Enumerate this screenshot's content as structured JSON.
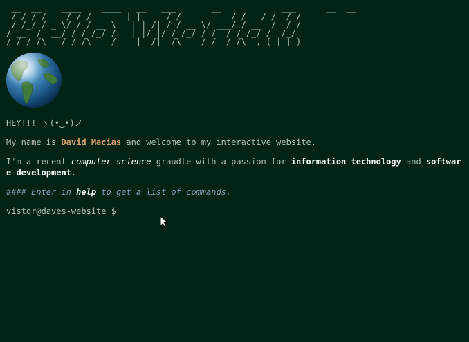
{
  "banner": {
    "ascii_text": " __  __    ____    ____   __   ___       __            ___      __  __  \n / / / /__  / / /___    | |     / /___  _____/ /___/ /  / /\n / /_/ / _ \\/ / / __ \\   | | /| / / __ \\/ ___/ / __  /  / /\n/ __  /  __/ / / /_/ /   | |/ |/ / /_/ / /  / / /_/ /  /_/\n/_/ /_/\\___/_/_/\\____/    |__/|__/\\____/_/  /_/\\__,_(_|_|_)"
  },
  "greeting": "HEY!!! ヽ(•‿•)ノ",
  "intro": {
    "prefix": "My name is ",
    "name": "David Macias",
    "suffix": " and welcome to my interactive website."
  },
  "bio": {
    "part1": "I'm a recent ",
    "em1": "computer science",
    "part2": " graudte with a passion for ",
    "strong1": "information technology",
    "part3": " and ",
    "strong2": "software development",
    "part4": "."
  },
  "hint": {
    "prefix": "#### Enter in ",
    "command": "help",
    "suffix": " to get a list of commands."
  },
  "prompt": {
    "label": "vistor@daves-website $",
    "input_value": ""
  },
  "colors": {
    "background": "#002413",
    "text": "#b7bdb8",
    "link": "#e0a36f",
    "hint": "#7e9bb5"
  },
  "icons": {
    "globe": "globe-icon",
    "cursor": "mouse-pointer-icon"
  }
}
